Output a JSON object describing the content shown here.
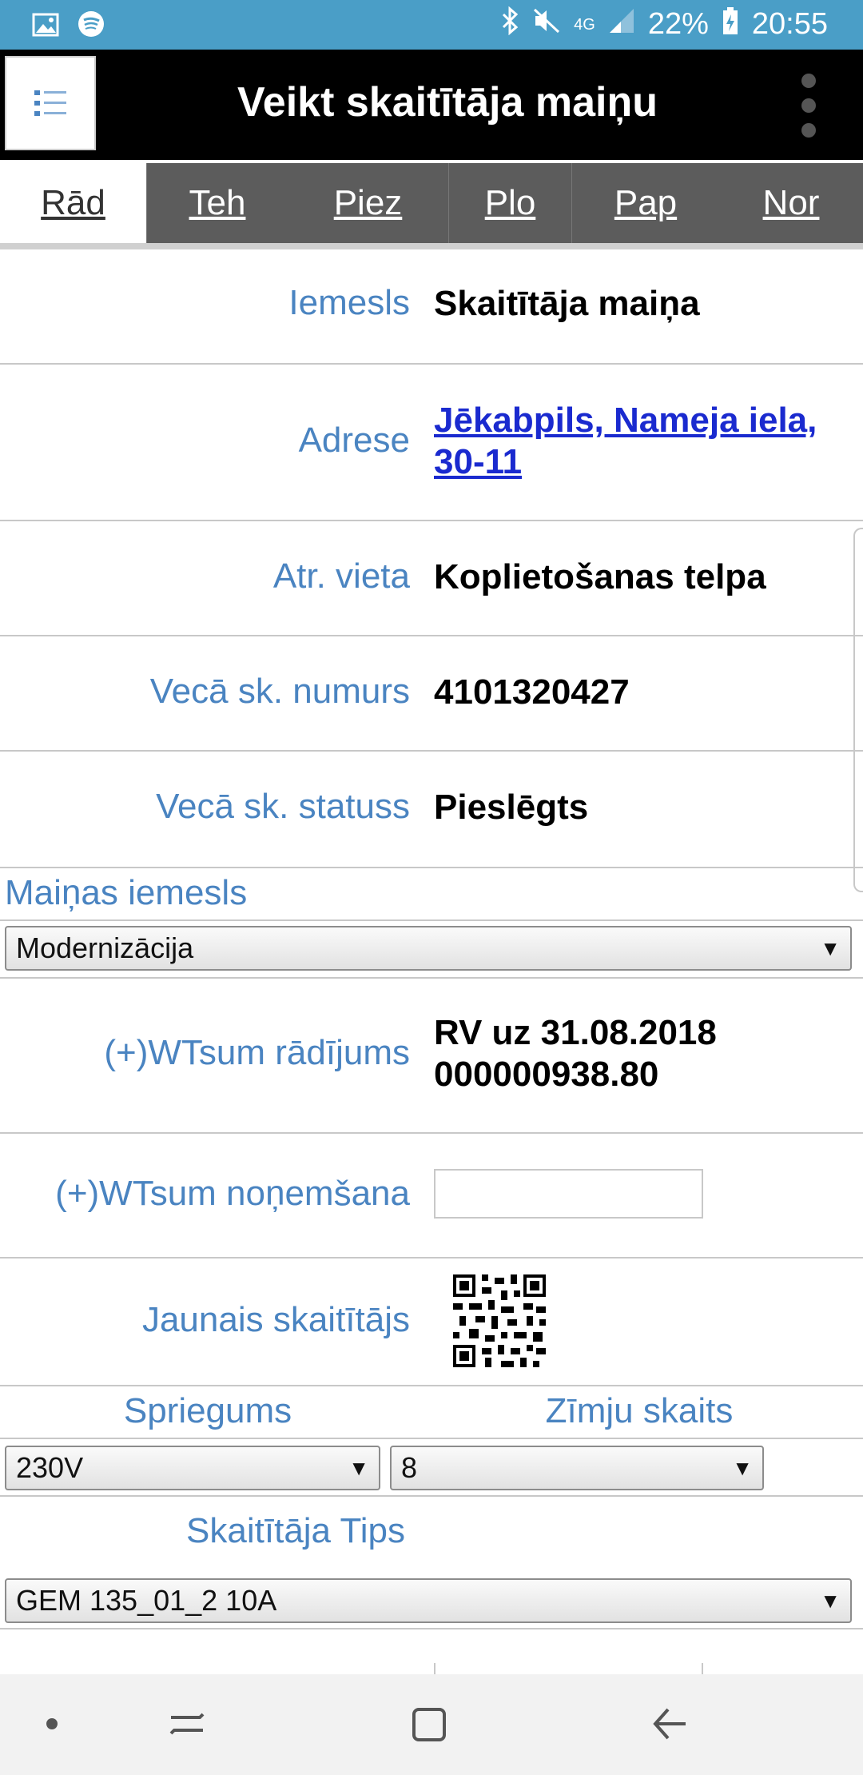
{
  "status_bar": {
    "battery": "22%",
    "time": "20:55",
    "network": "4G"
  },
  "app_bar": {
    "title": "Veikt skaitītāja maiņu"
  },
  "tabs": [
    {
      "label": "Rād",
      "active": true
    },
    {
      "label": "Teh",
      "active": false
    },
    {
      "label": "Piez",
      "active": false
    },
    {
      "label": "Plo",
      "active": false
    },
    {
      "label": "Pap",
      "active": false
    },
    {
      "label": "Nor",
      "active": false
    }
  ],
  "fields": {
    "reason": {
      "label": "Iemesls",
      "value": "Skaitītāja maiņa"
    },
    "address": {
      "label": "Adrese",
      "value_line1": "Jēkabpils, Nameja iela,",
      "value_line2": "30-11"
    },
    "location": {
      "label": "Atr. vieta",
      "value": "Koplietošanas telpa"
    },
    "old_number": {
      "label": "Vecā sk. numurs",
      "value": "4101320427"
    },
    "old_status": {
      "label": "Vecā sk. statuss",
      "value": "Pieslēgts"
    },
    "change_reason": {
      "label": "Maiņas iemesls",
      "selected": "Modernizācija"
    },
    "reading": {
      "label": "(+)WTsum rādījums",
      "value_line1": "RV uz 31.08.2018",
      "value_line2": "000000938.80"
    },
    "removal": {
      "label": "(+)WTsum noņemšana",
      "value": ""
    },
    "new_meter": {
      "label": "Jaunais skaitītājs"
    },
    "voltage": {
      "label": "Spriegums",
      "selected": "230V"
    },
    "digits": {
      "label": "Zīmju skaits",
      "selected": "8"
    },
    "meter_type": {
      "label": "Skaitītāja Tips",
      "selected": "GEM 135_01_2 10A"
    }
  },
  "colors": {
    "status_bar": "#4a9ec7",
    "app_bar": "#000000",
    "tab_bar": "#5c5c5c",
    "label": "#4a84c1",
    "link": "#1a2acf"
  }
}
